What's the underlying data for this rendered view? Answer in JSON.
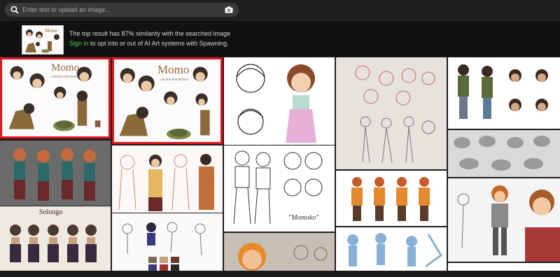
{
  "search": {
    "placeholder": "Enter text or upload an image..."
  },
  "icons": {
    "search": "magnifier-icon",
    "camera": "camera-icon"
  },
  "result_info": {
    "similarity_text": "The top result has 87% similarity with the searched image",
    "sign_in_link": "Sign in",
    "opt_text": " to opt into or out of AI Art systems with Spawning."
  },
  "colors": {
    "highlight": "#e0141c",
    "link": "#3fd23f",
    "background": "#1e1e1e"
  },
  "tiles": {
    "momo_title": "Momo",
    "momo_subtitle": "CHARACTER DESIGN",
    "solongo_title": "Solongo",
    "momoko_caption": "\"Momoko\""
  }
}
